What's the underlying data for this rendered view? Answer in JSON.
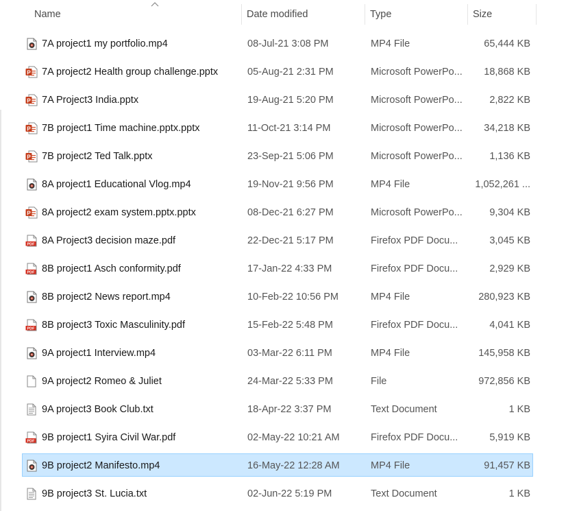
{
  "columns": {
    "name": "Name",
    "date": "Date modified",
    "type": "Type",
    "size": "Size"
  },
  "files": [
    {
      "name": "7A project1 my portfolio.mp4",
      "date": "08-Jul-21 3:08 PM",
      "type": "MP4 File",
      "size": "65,444 KB",
      "icon": "video-icon"
    },
    {
      "name": "7A project2 Health group challenge.pptx",
      "date": "05-Aug-21 2:31 PM",
      "type": "Microsoft PowerPo...",
      "size": "18,868 KB",
      "icon": "powerpoint-icon"
    },
    {
      "name": "7A Project3 India.pptx",
      "date": "19-Aug-21 5:20 PM",
      "type": "Microsoft PowerPo...",
      "size": "2,822 KB",
      "icon": "powerpoint-icon"
    },
    {
      "name": "7B project1 Time machine.pptx.pptx",
      "date": "11-Oct-21 3:14 PM",
      "type": "Microsoft PowerPo...",
      "size": "34,218 KB",
      "icon": "powerpoint-icon"
    },
    {
      "name": "7B project2 Ted Talk.pptx",
      "date": "23-Sep-21 5:06 PM",
      "type": "Microsoft PowerPo...",
      "size": "1,136 KB",
      "icon": "powerpoint-icon"
    },
    {
      "name": "8A project1 Educational Vlog.mp4",
      "date": "19-Nov-21 9:56 PM",
      "type": "MP4 File",
      "size": "1,052,261 ...",
      "icon": "video-icon"
    },
    {
      "name": "8A project2 exam system.pptx.pptx",
      "date": "08-Dec-21 6:27 PM",
      "type": "Microsoft PowerPo...",
      "size": "9,304 KB",
      "icon": "powerpoint-icon"
    },
    {
      "name": "8A Project3 decision maze.pdf",
      "date": "22-Dec-21 5:17 PM",
      "type": "Firefox PDF Docu...",
      "size": "3,045 KB",
      "icon": "pdf-icon"
    },
    {
      "name": "8B project1 Asch conformity.pdf",
      "date": "17-Jan-22 4:33 PM",
      "type": "Firefox PDF Docu...",
      "size": "2,929 KB",
      "icon": "pdf-icon"
    },
    {
      "name": "8B project2 News report.mp4",
      "date": "10-Feb-22 10:56 PM",
      "type": "MP4 File",
      "size": "280,923 KB",
      "icon": "video-icon"
    },
    {
      "name": "8B project3 Toxic Masculinity.pdf",
      "date": "15-Feb-22 5:48 PM",
      "type": "Firefox PDF Docu...",
      "size": "4,041 KB",
      "icon": "pdf-icon"
    },
    {
      "name": "9A project1 Interview.mp4",
      "date": "03-Mar-22 6:11 PM",
      "type": "MP4 File",
      "size": "145,958 KB",
      "icon": "video-icon"
    },
    {
      "name": "9A project2 Romeo & Juliet",
      "date": "24-Mar-22 5:33 PM",
      "type": "File",
      "size": "972,856 KB",
      "icon": "file-icon"
    },
    {
      "name": "9A project3 Book Club.txt",
      "date": "18-Apr-22 3:37 PM",
      "type": "Text Document",
      "size": "1 KB",
      "icon": "text-file-icon"
    },
    {
      "name": "9B project1 Syira Civil War.pdf",
      "date": "02-May-22 10:21 AM",
      "type": "Firefox PDF Docu...",
      "size": "5,919 KB",
      "icon": "pdf-icon"
    },
    {
      "name": "9B project2 Manifesto.mp4",
      "date": "16-May-22 12:28 AM",
      "type": "MP4 File",
      "size": "91,457 KB",
      "icon": "video-icon",
      "selected": true
    },
    {
      "name": "9B project3 St. Lucia.txt",
      "date": "02-Jun-22 5:19 PM",
      "type": "Text Document",
      "size": "1 KB",
      "icon": "text-file-icon"
    }
  ]
}
